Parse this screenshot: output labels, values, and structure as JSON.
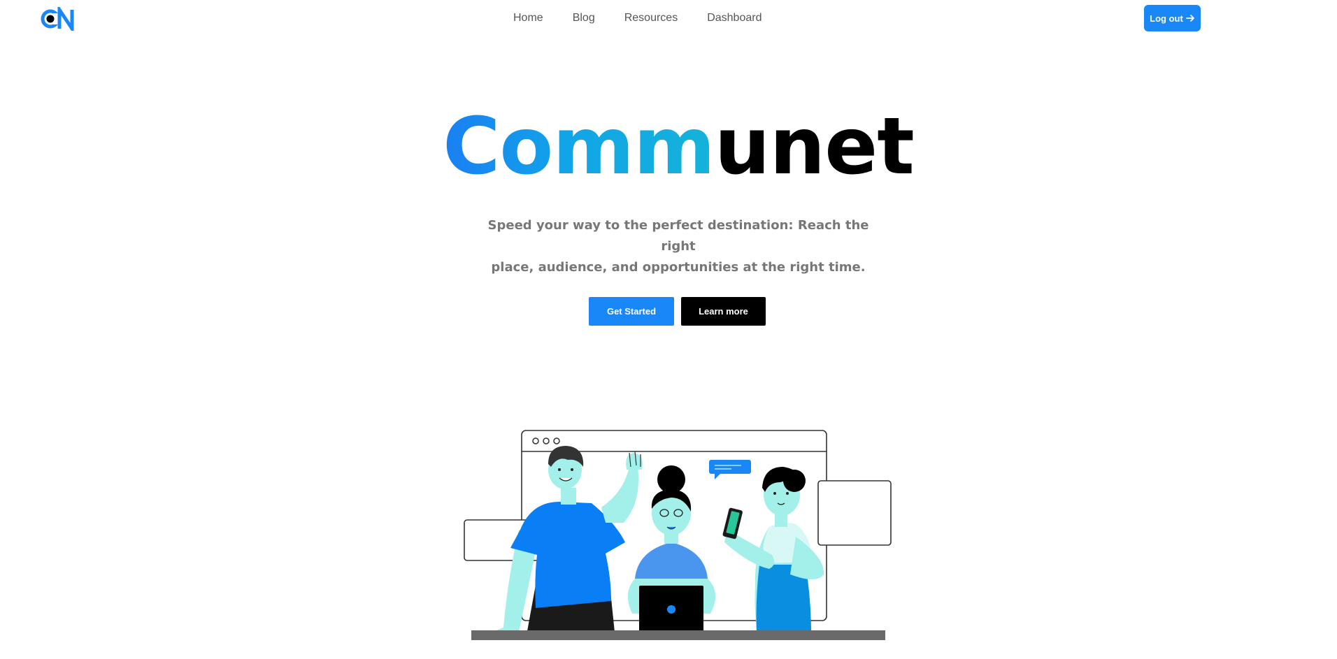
{
  "header": {
    "logo_text": "CN",
    "nav": [
      {
        "label": "Home"
      },
      {
        "label": "Blog"
      },
      {
        "label": "Resources"
      },
      {
        "label": "Dashboard"
      }
    ],
    "logout_label": "Log out"
  },
  "hero": {
    "title_part1": "Comm",
    "title_part2": "unet",
    "subtitle_line1": "Speed your way to the perfect destination: Reach the right",
    "subtitle_line2": "place, audience, and opportunities at the right time.",
    "get_started_label": "Get Started",
    "learn_more_label": "Learn more"
  },
  "colors": {
    "accent": "#1a87f8",
    "gradient_start": "#1a7ff2",
    "gradient_end": "#14b3d9",
    "text_dark": "#000000",
    "text_muted": "#777777",
    "skin": "#a3f0ea"
  },
  "icons": {
    "logout": "arrow-right-icon",
    "logo": "cn-logo-icon"
  }
}
